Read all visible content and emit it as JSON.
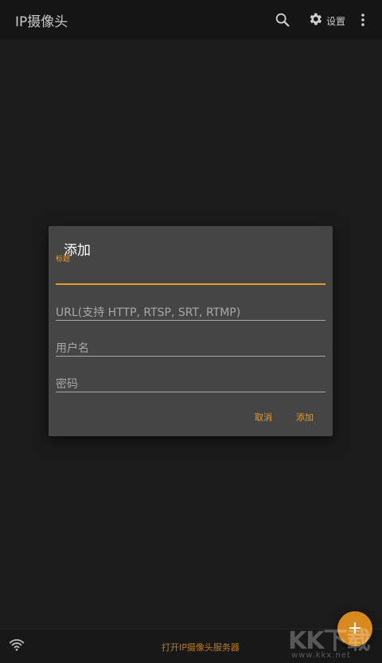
{
  "appbar": {
    "title": "IP摄像头",
    "search_icon": "search-icon",
    "settings_icon": "gear-icon",
    "settings_label": "设置",
    "more_icon": "more-vert-icon"
  },
  "dialog": {
    "title": "添加",
    "fields": [
      {
        "float_label": "标题",
        "value": "",
        "placeholder": ""
      },
      {
        "value": "",
        "placeholder": "URL(支持 HTTP, RTSP, SRT, RTMP)"
      },
      {
        "value": "",
        "placeholder": "用户名"
      },
      {
        "value": "",
        "placeholder": "密码"
      }
    ],
    "cancel_label": "取消",
    "add_label": "添加"
  },
  "bottombar": {
    "wifi_icon": "wifi-icon",
    "server_label": "打开IP摄像头服务器"
  },
  "fab": {
    "icon": "plus-icon",
    "label": "+"
  },
  "watermark": {
    "letters": "KK下载",
    "url": "www.kkx.net"
  },
  "colors": {
    "accent": "#e89a26",
    "background": "#1b1b1b",
    "dialog": "#454545"
  }
}
